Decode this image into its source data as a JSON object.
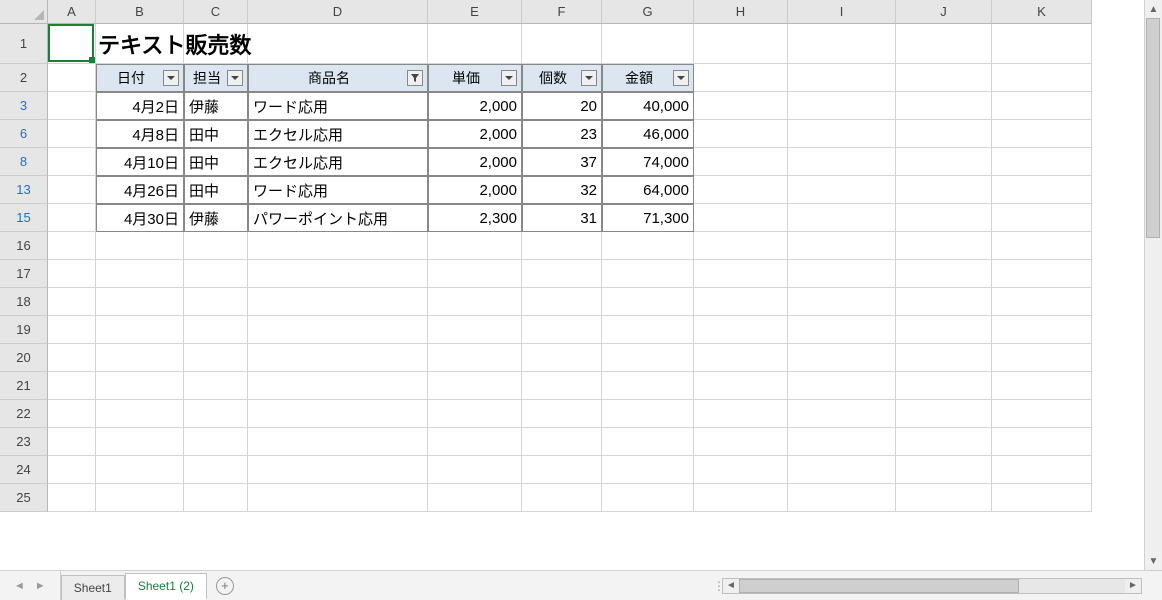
{
  "columns": [
    {
      "letter": "A",
      "width": 48
    },
    {
      "letter": "B",
      "width": 88
    },
    {
      "letter": "C",
      "width": 64
    },
    {
      "letter": "D",
      "width": 180
    },
    {
      "letter": "E",
      "width": 94
    },
    {
      "letter": "F",
      "width": 80
    },
    {
      "letter": "G",
      "width": 92
    },
    {
      "letter": "H",
      "width": 94
    },
    {
      "letter": "I",
      "width": 108
    },
    {
      "letter": "J",
      "width": 96
    },
    {
      "letter": "K",
      "width": 100
    }
  ],
  "row_labels": [
    "1",
    "2",
    "3",
    "6",
    "8",
    "13",
    "15",
    "16",
    "17",
    "18",
    "19",
    "20",
    "21",
    "22",
    "23",
    "24",
    "25"
  ],
  "filtered_rows": [
    "3",
    "6",
    "8",
    "13",
    "15"
  ],
  "row_heights": {
    "1": 40,
    "default": 28
  },
  "title": "テキスト販売数",
  "table": {
    "headers": [
      {
        "label": "日付",
        "filter": "dropdown"
      },
      {
        "label": "担当",
        "filter": "dropdown"
      },
      {
        "label": "商品名",
        "filter": "active"
      },
      {
        "label": "単価",
        "filter": "dropdown"
      },
      {
        "label": "個数",
        "filter": "dropdown"
      },
      {
        "label": "金額",
        "filter": "dropdown"
      }
    ],
    "rows": [
      {
        "date": "4月2日",
        "staff": "伊藤",
        "product": "ワード応用",
        "price": "2,000",
        "qty": "20",
        "amount": "40,000"
      },
      {
        "date": "4月8日",
        "staff": "田中",
        "product": "エクセル応用",
        "price": "2,000",
        "qty": "23",
        "amount": "46,000"
      },
      {
        "date": "4月10日",
        "staff": "田中",
        "product": "エクセル応用",
        "price": "2,000",
        "qty": "37",
        "amount": "74,000"
      },
      {
        "date": "4月26日",
        "staff": "田中",
        "product": "ワード応用",
        "price": "2,000",
        "qty": "32",
        "amount": "64,000"
      },
      {
        "date": "4月30日",
        "staff": "伊藤",
        "product": "パワーポイント応用",
        "price": "2,300",
        "qty": "31",
        "amount": "71,300"
      }
    ]
  },
  "tabs": {
    "items": [
      "Sheet1",
      "Sheet1 (2)"
    ],
    "active": 1
  },
  "selected_cell": "A1"
}
